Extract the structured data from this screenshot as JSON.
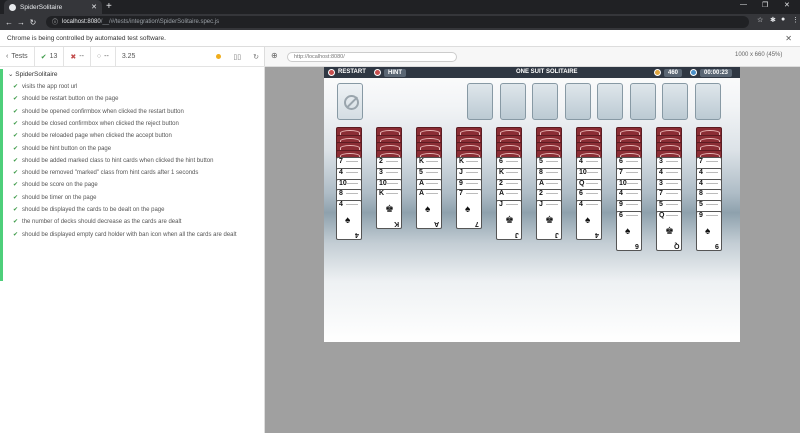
{
  "browser": {
    "tab_title": "SpiderSolitaire",
    "url_host": "localhost:8080",
    "url_path": "/__/#/tests/integration\\SpiderSolitaire.spec.js",
    "infobar_text": "Chrome is being controlled by automated test software."
  },
  "runner": {
    "tests_label": "Tests",
    "passed": "13",
    "failed": "--",
    "pending": "--",
    "duration": "3.25",
    "suite_title": "SpiderSolitaire",
    "tests": [
      "visits the app root url",
      "should be restart button on the page",
      "should be opened confirmbox when clicked the restart button",
      "should be closed confirmbox when clicked the reject button",
      "should be reloaded page when clicked the accept button",
      "should be hint button on the page",
      "should be added marked class to hint cards when clicked the hint button",
      "should be removed \"marked\" class from hint cards after 1 seconds",
      "should be score on the page",
      "should be timer on the page",
      "should be displayed the cards to be dealt on the page",
      "the number of decks should decrease as the cards are dealt",
      "should be displayed empty card holder with ban icon when all the cards are dealt"
    ]
  },
  "aut": {
    "url": "http://localhost:8080/",
    "viewport": "1000 x 660",
    "viewport_scale": "(45%)"
  },
  "game": {
    "restart_label": "RESTART",
    "hint_label": "HINT",
    "title": "ONE SUIT SOLITAIRE",
    "score": "460",
    "timer": "00:00:23",
    "piles": [
      {
        "ranks": [
          "7",
          "4",
          "10",
          "8",
          "4"
        ],
        "bottom": "4",
        "big": "♠"
      },
      {
        "ranks": [
          "2",
          "3",
          "10",
          "K"
        ],
        "bottom": "K",
        "big": "♚"
      },
      {
        "ranks": [
          "K",
          "5",
          "A",
          "A"
        ],
        "bottom": "A",
        "big": "♠"
      },
      {
        "ranks": [
          "K",
          "J",
          "9",
          "7"
        ],
        "bottom": "7",
        "big": "♠"
      },
      {
        "ranks": [
          "6",
          "K",
          "2",
          "A",
          "J"
        ],
        "bottom": "J",
        "big": "♚"
      },
      {
        "ranks": [
          "5",
          "8",
          "A",
          "2",
          "J"
        ],
        "bottom": "J",
        "big": "♚"
      },
      {
        "ranks": [
          "4",
          "10",
          "Q",
          "6",
          "4"
        ],
        "bottom": "4",
        "big": "♠"
      },
      {
        "ranks": [
          "6",
          "7",
          "10",
          "4",
          "9",
          "6"
        ],
        "bottom": "6",
        "big": "♠"
      },
      {
        "ranks": [
          "3",
          "4",
          "3",
          "7",
          "5",
          "Q"
        ],
        "bottom": "Q",
        "big": "♚"
      },
      {
        "ranks": [
          "7",
          "4",
          "4",
          "8",
          "5",
          "9"
        ],
        "bottom": "9",
        "big": "♠"
      }
    ]
  }
}
